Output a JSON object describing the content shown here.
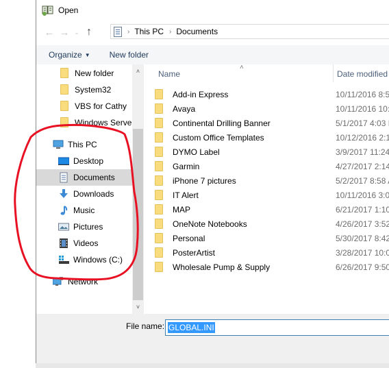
{
  "window": {
    "title": "Open",
    "icon": "open-dialog-icon"
  },
  "navigation": {
    "back_icon": "arrow-left-icon",
    "forward_icon": "arrow-right-icon",
    "recent_icon": "chevron-down-icon",
    "up_icon": "arrow-up-icon",
    "back_glyph": "←",
    "forward_glyph": "→",
    "recent_glyph": "⌄",
    "up_glyph": "↑",
    "breadcrumb": [
      {
        "label": "This PC"
      },
      {
        "label": "Documents"
      }
    ],
    "breadcrumb_separator": "›"
  },
  "toolbar": {
    "organize_label": "Organize",
    "organize_caret": "▼",
    "new_folder_label": "New folder"
  },
  "tree": {
    "items": [
      {
        "label": "New folder",
        "icon": "folder-icon"
      },
      {
        "label": "System32",
        "icon": "folder-icon"
      },
      {
        "label": "VBS for Cathy",
        "icon": "folder-icon"
      },
      {
        "label": "Windows Server",
        "icon": "folder-icon"
      },
      {
        "label": "This PC",
        "icon": "computer-icon"
      },
      {
        "label": "Desktop",
        "icon": "desktop-icon"
      },
      {
        "label": "Documents",
        "icon": "documents-icon",
        "selected": true
      },
      {
        "label": "Downloads",
        "icon": "download-icon"
      },
      {
        "label": "Music",
        "icon": "music-icon"
      },
      {
        "label": "Pictures",
        "icon": "pictures-icon"
      },
      {
        "label": "Videos",
        "icon": "videos-icon"
      },
      {
        "label": "Windows (C:)",
        "icon": "drive-icon"
      },
      {
        "label": "Network",
        "icon": "network-icon"
      }
    ],
    "scroll_up_glyph": "˄",
    "scroll_down_glyph": "˅"
  },
  "list": {
    "columns": [
      {
        "label": "Name"
      },
      {
        "label": "Date modified"
      }
    ],
    "sort_glyph": "˄",
    "rows": [
      {
        "name": "Add-in Express",
        "date": "10/11/2016 8:5"
      },
      {
        "name": "Avaya",
        "date": "10/11/2016 10:"
      },
      {
        "name": "Continental Drilling Banner",
        "date": "5/1/2017 4:03 P"
      },
      {
        "name": "Custom Office Templates",
        "date": "10/12/2016 2:1"
      },
      {
        "name": "DYMO Label",
        "date": "3/9/2017 11:24"
      },
      {
        "name": "Garmin",
        "date": "4/27/2017 2:14"
      },
      {
        "name": "iPhone 7 pictures",
        "date": "5/2/2017 8:58 A"
      },
      {
        "name": "IT Alert",
        "date": "10/11/2016 3:0"
      },
      {
        "name": "MAP",
        "date": "6/21/2017 1:10"
      },
      {
        "name": "OneNote Notebooks",
        "date": "4/26/2017 3:52"
      },
      {
        "name": "Personal",
        "date": "5/30/2017 8:42"
      },
      {
        "name": "PosterArtist",
        "date": "3/28/2017 10:0"
      },
      {
        "name": "Wholesale Pump & Supply",
        "date": "6/26/2017 9:50"
      }
    ]
  },
  "filename": {
    "label": "File name:",
    "value": "GLOBAL.INI"
  },
  "annotation": {
    "color": "#e81123",
    "description": "red hand-drawn circle around This PC group"
  }
}
